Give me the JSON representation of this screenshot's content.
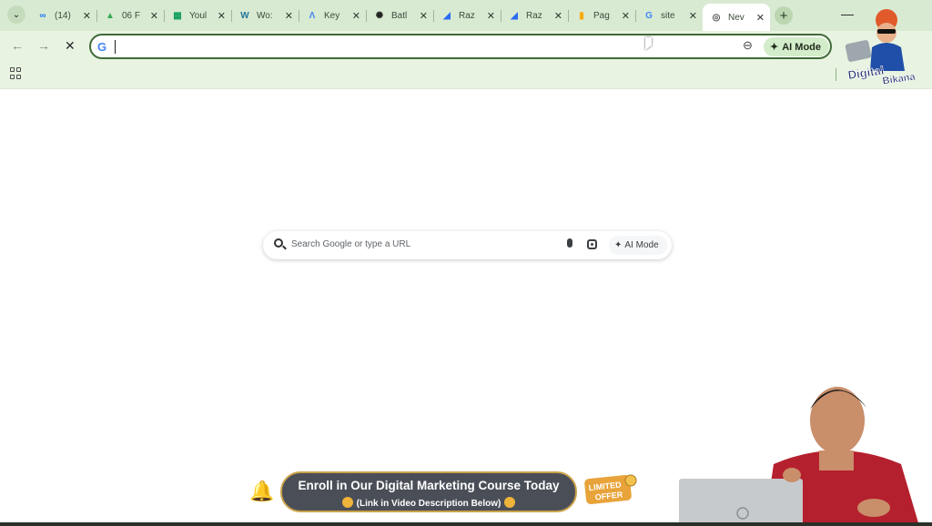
{
  "tabs": [
    {
      "title": "(14)",
      "icon": "meta-icon",
      "color": "#1877f2",
      "glyph": "∞"
    },
    {
      "title": "06 F",
      "icon": "google-drive-icon",
      "color": "#34a853",
      "glyph": "▲"
    },
    {
      "title": "Youl",
      "icon": "google-sheets-icon",
      "color": "#0f9d58",
      "glyph": "▦"
    },
    {
      "title": "Wo:",
      "icon": "wordpress-icon",
      "color": "#21759b",
      "glyph": "W"
    },
    {
      "title": "Key",
      "icon": "google-ads-icon",
      "color": "#4285f4",
      "glyph": "Λ"
    },
    {
      "title": "Batl",
      "icon": "chatgpt-icon",
      "color": "#222222",
      "glyph": "✺"
    },
    {
      "title": "Raz",
      "icon": "razorpay-icon",
      "color": "#2b6cf6",
      "glyph": "◢"
    },
    {
      "title": "Raz",
      "icon": "razorpay-icon",
      "color": "#2b6cf6",
      "glyph": "◢"
    },
    {
      "title": "Pag",
      "icon": "analytics-icon",
      "color": "#f9ab00",
      "glyph": "▮"
    },
    {
      "title": "site",
      "icon": "google-icon",
      "color": "#4285f4",
      "glyph": "G"
    },
    {
      "title": "Nev",
      "icon": "chrome-newtab-icon",
      "color": "#555555",
      "glyph": "◎"
    }
  ],
  "active_tab_index": 10,
  "omnibox": {
    "value": "",
    "ai_mode_label": "AI Mode"
  },
  "ntp": {
    "search_placeholder": "Search Google or type a URL",
    "ai_mode_label": "AI Mode"
  },
  "promo": {
    "headline": "Enroll in Our Digital Marketing Course Today",
    "subline": "(Link in Video Description Below)",
    "badge_line1": "LIMITED",
    "badge_line2": "OFFER"
  },
  "logo": {
    "line1": "Digital",
    "line2": "Bikana"
  },
  "colors": {
    "tabstrip": "#d9ead3",
    "toolbar": "#e8f3e2",
    "omnibox_border": "#3f6a37",
    "promo_bg": "#4a4e57",
    "promo_border": "#c9a24a"
  }
}
